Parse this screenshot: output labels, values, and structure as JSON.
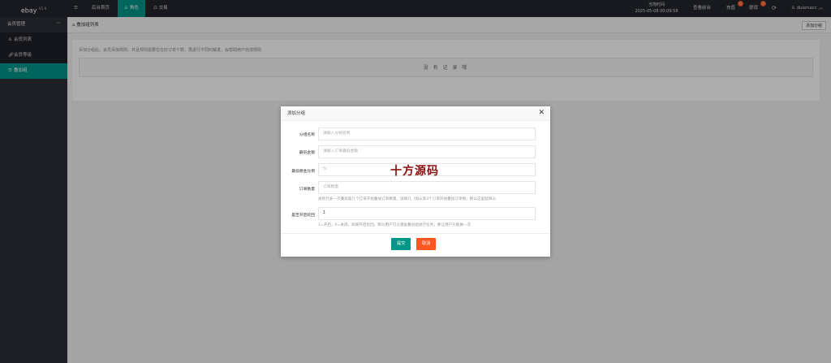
{
  "app": {
    "logo": "ebay",
    "version": "V1.6"
  },
  "topnav": {
    "menu_icon": "menu-icon",
    "items": [
      {
        "label": "后台首页"
      },
      {
        "label": "角色",
        "icon": "user-icon",
        "active": true
      },
      {
        "label": "交易",
        "icon": "scale-icon"
      }
    ]
  },
  "header_right": {
    "clock_line1": "当地时间",
    "clock_line2": "2025-05-08 00:09:58",
    "view_frontend": "查看前台",
    "recharge": "充值",
    "recharge_badge": "0",
    "withdraw": "提现",
    "withdraw_badge": "0",
    "refresh_icon": "refresh-icon",
    "username": "duomacc"
  },
  "sidebar": {
    "group": "会员管理",
    "items": [
      {
        "label": "会员列表",
        "icon": "user-icon"
      },
      {
        "label": "会员等级",
        "icon": "link-icon"
      },
      {
        "label": "叠加组",
        "icon": "list-icon",
        "active": true
      }
    ]
  },
  "main": {
    "breadcrumb": "叠加组列表",
    "add_button": "添加分组",
    "tip": "添加分组后，会员添加规则，并且规则需要在在好订单个数，再进行不同时触发，会帮助用户完成规则",
    "empty": "没 有 记 录 哦"
  },
  "modal": {
    "title": "添加分组",
    "fields": [
      {
        "label": "分组名称",
        "placeholder": "请输入分组名称"
      },
      {
        "label": "最低金额",
        "placeholder": "请输入订单最低金额"
      },
      {
        "label": "最低佣金比例",
        "placeholder": "%"
      },
      {
        "label": "订单数量",
        "placeholder": "订单数量"
      },
      {
        "label": "是否开启轮回",
        "value": "1"
      }
    ],
    "hint_orders": "规则代表一次叠加第几个订单开始叠加订单数量，就填几（如从第3个订单开始叠加订单数，那么这里就填3）",
    "hint_loop": "1=开启，0=关闭，如果开启轮回，那么用户可以重复叠加组进行任务，要让用户只能做一次",
    "submit": "提交",
    "cancel": "取消",
    "watermark": "十方源码"
  }
}
